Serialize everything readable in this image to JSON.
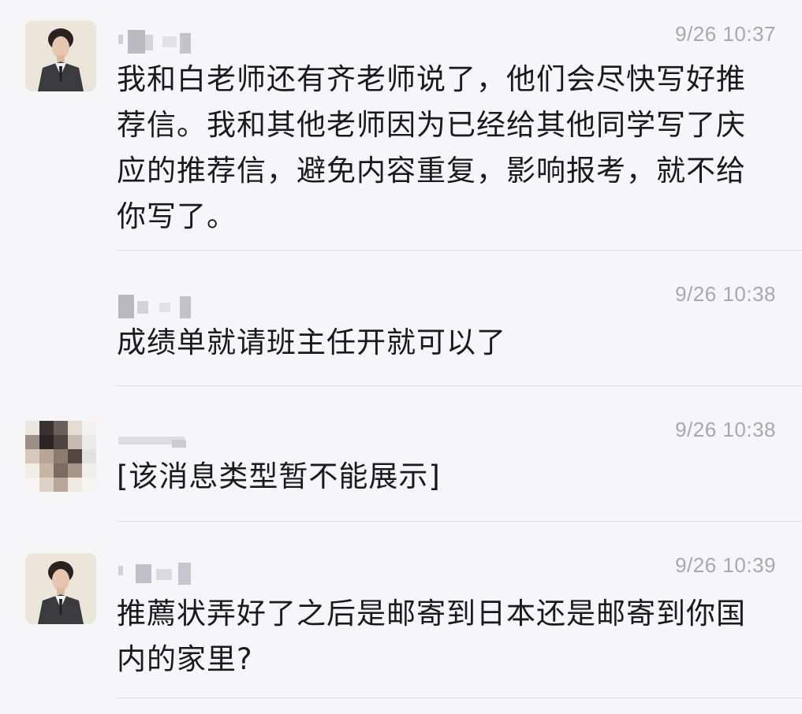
{
  "messages": [
    {
      "time": "9/26 10:37",
      "text": "我和白老师还有齐老师说了，他们会尽快写好推荐信。我和其他老师因为已经给其他同学写了庆应的推荐信，避免内容重复，影响报考，就不给你写了。"
    },
    {
      "time": "9/26 10:38",
      "text": "成绩单就请班主任开就可以了"
    },
    {
      "time": "9/26 10:38",
      "text": "[该消息类型暂不能展示]"
    },
    {
      "time": "9/26 10:39",
      "text": "推薦状弄好了之后是邮寄到日本还是邮寄到你国内的家里?"
    }
  ],
  "icons": {
    "teacher_avatar": "teacher-avatar",
    "pixelated_avatar": "pixelated-avatar",
    "name_mosaic": "name-mosaic"
  },
  "colors": {
    "background": "#f6f6f8",
    "text": "#1a1a1a",
    "timestamp": "#a8a8ae",
    "divider": "#dddde2"
  }
}
